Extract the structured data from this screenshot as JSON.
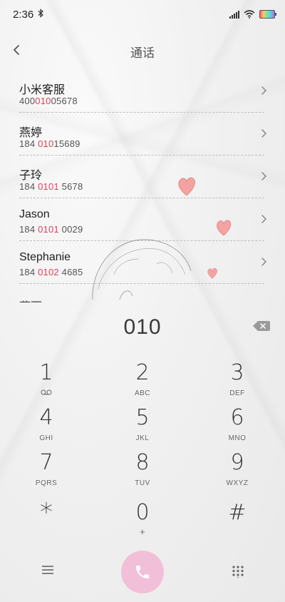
{
  "status_bar": {
    "time": "2:36"
  },
  "header": {
    "title": "通话"
  },
  "contacts": [
    {
      "name": "小米客服",
      "number_parts": [
        "400",
        "010",
        "05678"
      ]
    },
    {
      "name": "燕婷",
      "number_parts": [
        "184 ",
        "010",
        "15689"
      ]
    },
    {
      "name": "子玲",
      "number_parts": [
        "184 ",
        "0101",
        " 5678"
      ]
    },
    {
      "name": "Jason",
      "number_parts": [
        "184 ",
        "0101",
        " 0029"
      ]
    },
    {
      "name": "Stephanie",
      "number_parts": [
        "184 ",
        "0102",
        " 4685"
      ]
    }
  ],
  "partial_contact": "燕雨",
  "dial": {
    "number": "010"
  },
  "keypad": [
    {
      "digit": "1",
      "letters": ""
    },
    {
      "digit": "2",
      "letters": "ABC"
    },
    {
      "digit": "3",
      "letters": "DEF"
    },
    {
      "digit": "4",
      "letters": "GHI"
    },
    {
      "digit": "5",
      "letters": "JKL"
    },
    {
      "digit": "6",
      "letters": "MNO"
    },
    {
      "digit": "7",
      "letters": "PQRS"
    },
    {
      "digit": "8",
      "letters": "TUV"
    },
    {
      "digit": "9",
      "letters": "WXYZ"
    },
    {
      "digit": "*",
      "letters": ""
    },
    {
      "digit": "0",
      "letters": "+"
    },
    {
      "digit": "#",
      "letters": ""
    }
  ],
  "colors": {
    "highlight": "#e2405b",
    "call_button": "#f2bfd8",
    "heart": "#f19a9a"
  },
  "icons": {
    "back": "chevron-left-icon",
    "row": "chevron-right-icon",
    "backspace": "backspace-icon",
    "voicemail": "voicemail-icon",
    "menu": "menu-icon",
    "call": "phone-icon",
    "dialpad": "dialpad-icon"
  }
}
